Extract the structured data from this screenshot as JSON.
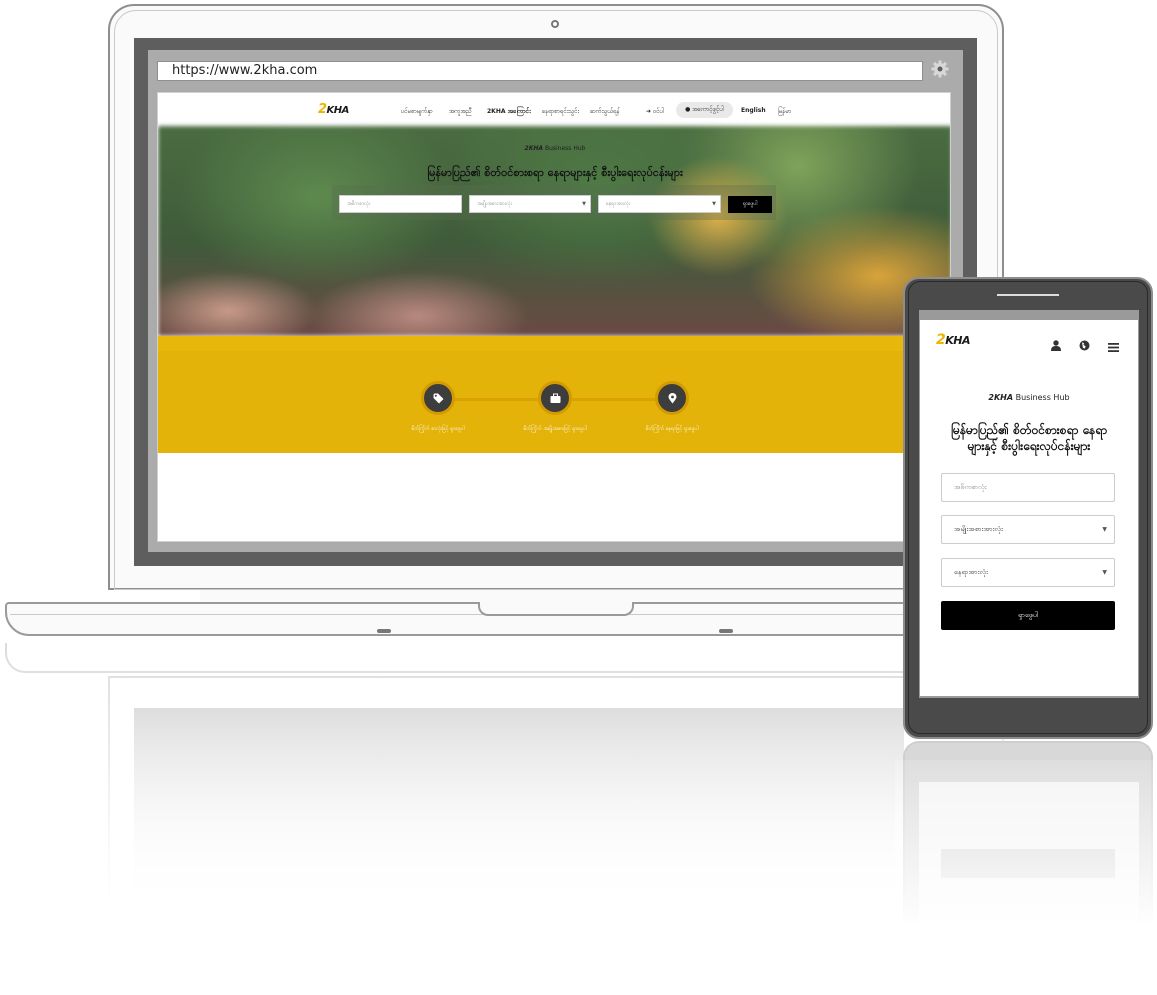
{
  "browser": {
    "url": "https://www.2kha.com",
    "settings_icon": "gear-icon"
  },
  "site": {
    "logo_two": "2",
    "logo_kha": "KHA",
    "nav": {
      "items": [
        "ပင်မစာမျက်နှာ",
        "အကူအညီ",
        "2KHA အကြောင်း",
        "နေရာစာရင်းသွင်း",
        "ဆက်သွယ်ရန်"
      ],
      "login": "ဝင်ပါ",
      "register": "အကောင့်ဖွင့်ပါ",
      "lang_en": "English",
      "lang_mm": "မြန်မာ"
    },
    "hero": {
      "hub_brand": "2KHA",
      "hub_suffix": "Business Hub",
      "headline": "မြန်မာပြည်၏ စိတ်ဝင်စားစရာ နေရာများနှင့် စီးပွါးရေးလုပ်ငန်းများ",
      "keyword_placeholder": "အဓိကစာလုံး",
      "category_select": "အမျိုးအစားအားလုံး",
      "location_select": "နေရာအားလုံး",
      "search_button": "ရှာဖွေပါ"
    },
    "features": [
      {
        "icon": "tag-icon",
        "label": "စိတ်ကြိုက် စာလုံးဖြင့် ရှာဖွေပါ"
      },
      {
        "icon": "briefcase-icon",
        "label": "စိတ်ကြိုက် အမျိုးအစားဖြင့် ရှာဖွေပါ"
      },
      {
        "icon": "map-marker-icon",
        "label": "စိတ်ကြိုက် နေရာဖြင့် ရှာဖွေပါ"
      }
    ],
    "colors": {
      "accent_yellow": "#e3b30a",
      "brand_orange": "#f0b400",
      "dark": "#000000"
    }
  },
  "mobile": {
    "icons": [
      "user-icon",
      "globe-icon",
      "menu-icon"
    ],
    "hub_brand": "2KHA",
    "hub_suffix": "Business Hub",
    "headline_line1": "မြန်မာပြည်၏ စိတ်ဝင်စားစရာ နေရာ",
    "headline_line2": "များနှင့် စီးပွါးရေးလုပ်ငန်းများ",
    "keyword_placeholder": "အဓိကစာလုံး",
    "category_select": "အမျိုးအစားအားလုံး",
    "location_select": "နေရာအားလုံး",
    "search_button": "ရှာဖွေပါ"
  }
}
